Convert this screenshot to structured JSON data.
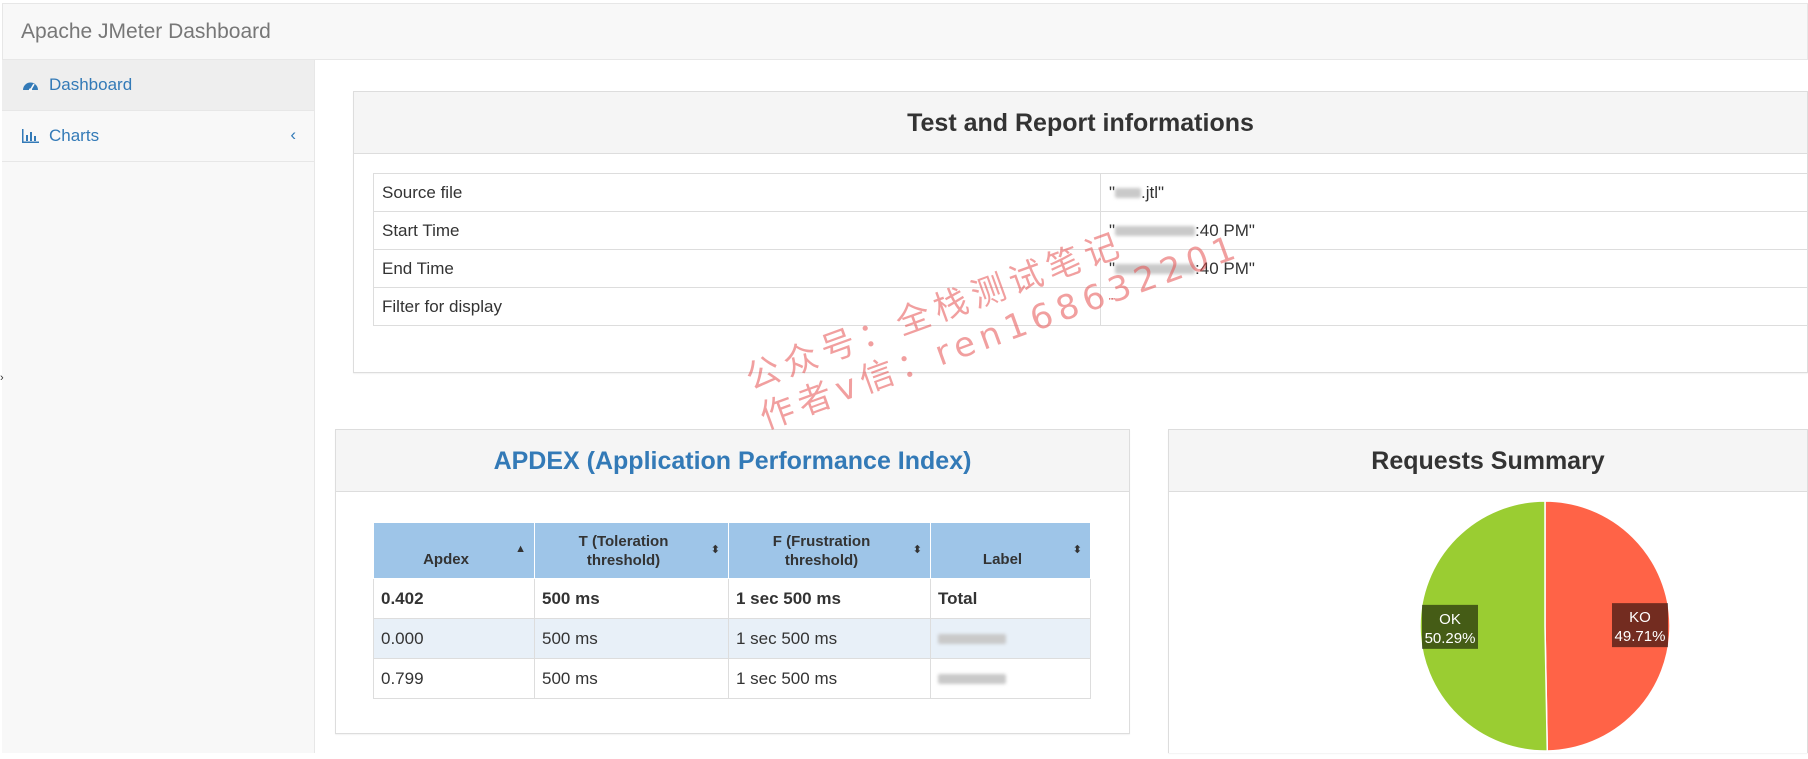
{
  "navbar": {
    "brand": "Apache JMeter Dashboard"
  },
  "sidebar": {
    "items": [
      {
        "label": "Dashboard",
        "icon": "dashboard-icon",
        "active": true
      },
      {
        "label": "Charts",
        "icon": "bar-chart-icon",
        "expandable": true
      }
    ]
  },
  "info_panel": {
    "title": "Test and Report informations",
    "rows": [
      {
        "key": "Source file",
        "value": ".jtl\""
      },
      {
        "key": "Start Time",
        "value": ":40 PM\""
      },
      {
        "key": "End Time",
        "value": ":40 PM\""
      },
      {
        "key": "Filter for display",
        "value": "\"\""
      }
    ]
  },
  "apdex_panel": {
    "title": "APDEX (Application Performance Index)",
    "headers": [
      "Apdex",
      "T (Toleration threshold)",
      "F (Frustration threshold)",
      "Label"
    ],
    "rows": [
      {
        "apdex": "0.402",
        "t": "500 ms",
        "f": "1 sec 500 ms",
        "label": "Total"
      },
      {
        "apdex": "0.000",
        "t": "500 ms",
        "f": "1 sec 500 ms",
        "label": ""
      },
      {
        "apdex": "0.799",
        "t": "500 ms",
        "f": "1 sec 500 ms",
        "label": ""
      }
    ]
  },
  "summary_panel": {
    "title": "Requests Summary",
    "chart_data": {
      "type": "pie",
      "title": "Requests Summary",
      "slices": [
        {
          "label": "KO",
          "value": 49.71,
          "display": "49.71%",
          "color": "#ff6347"
        },
        {
          "label": "OK",
          "value": 50.29,
          "display": "50.29%",
          "color": "#9acd32"
        }
      ]
    }
  },
  "watermark": {
    "line1": "公众号：全栈测试笔记",
    "line2": "作者v信：ren168632201"
  },
  "colors": {
    "link": "#337ab7",
    "header_bg": "#9ec5e8",
    "ko": "#ff6347",
    "ok": "#9acd32"
  }
}
